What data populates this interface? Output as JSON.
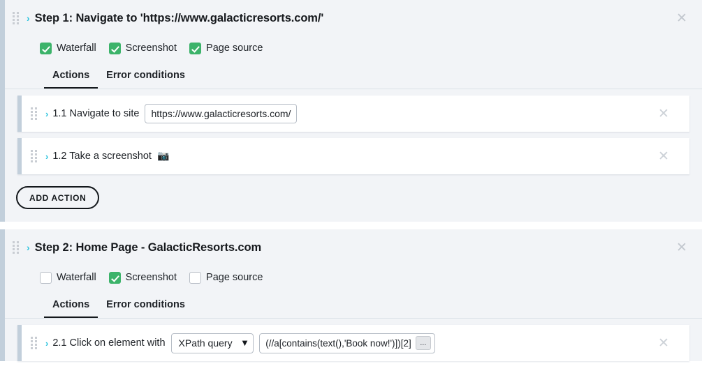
{
  "steps": [
    {
      "id": "step-1",
      "chevron": "›",
      "title": "Step 1: Navigate to 'https://www.galacticresorts.com/'",
      "close_icon": "✕",
      "checkboxes": [
        {
          "label": "Waterfall",
          "checked": true
        },
        {
          "label": "Screenshot",
          "checked": true
        },
        {
          "label": "Page source",
          "checked": true
        }
      ],
      "tabs": [
        {
          "label": "Actions",
          "active": true
        },
        {
          "label": "Error conditions",
          "active": false
        }
      ],
      "actions": [
        {
          "chevron": "›",
          "number": "1.1",
          "text": "1.1 Navigate to site",
          "field_value": "https://www.galacticresorts.com/",
          "close_icon": "✕"
        },
        {
          "chevron": "›",
          "number": "1.2",
          "text": "1.2 Take a screenshot",
          "emoji": "📷",
          "close_icon": "✕"
        }
      ],
      "add_action_label": "ADD ACTION"
    },
    {
      "id": "step-2",
      "chevron": "›",
      "title": "Step 2: Home Page - GalacticResorts.com",
      "close_icon": "✕",
      "checkboxes": [
        {
          "label": "Waterfall",
          "checked": false
        },
        {
          "label": "Screenshot",
          "checked": true
        },
        {
          "label": "Page source",
          "checked": false
        }
      ],
      "tabs": [
        {
          "label": "Actions",
          "active": true
        },
        {
          "label": "Error conditions",
          "active": false
        }
      ],
      "actions": [
        {
          "chevron": "›",
          "number": "2.1",
          "text": "2.1 Click on element with",
          "select_value": "XPath query",
          "select_caret": "❯",
          "xpath_value": "(//a[contains(text(),'Book now!')])[2]",
          "ellipsis_label": "...",
          "close_icon": "✕"
        }
      ]
    }
  ],
  "colors": {
    "chevron_teal": "#2ec4de",
    "checkbox_green": "#3cb36a",
    "card_accent": "#c2cfdb",
    "card_bg": "#f2f4f7",
    "tab_underline": "#14181c"
  }
}
